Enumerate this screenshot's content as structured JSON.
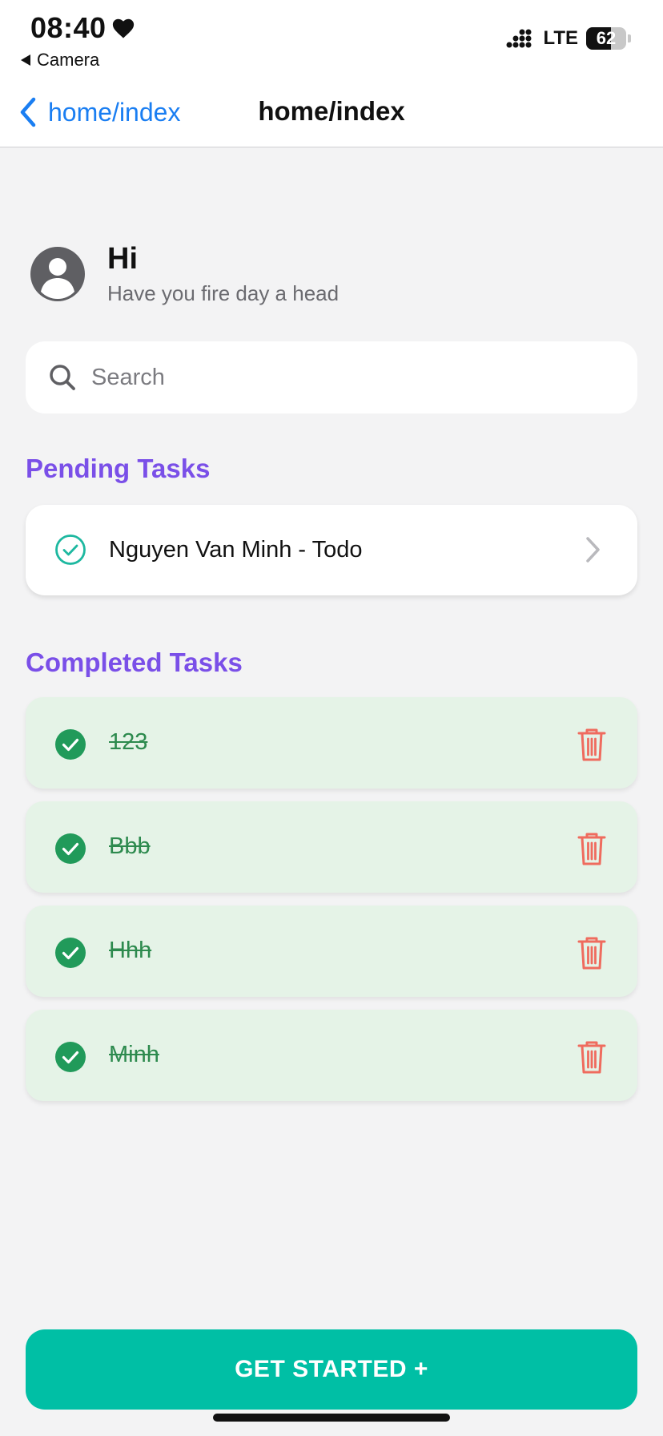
{
  "status_bar": {
    "time": "08:40",
    "back_app": "Camera",
    "network": "LTE",
    "battery": "62",
    "battery_level": 0.62
  },
  "nav": {
    "back_label": "home/index",
    "title": "home/index"
  },
  "greeting": {
    "title": "Hi",
    "subtitle": "Have you fire day a head"
  },
  "search": {
    "placeholder": "Search"
  },
  "pending": {
    "section_title": "Pending Tasks",
    "items": [
      {
        "label": "Nguyen Van Minh - Todo"
      }
    ]
  },
  "completed": {
    "section_title": "Completed Tasks",
    "items": [
      {
        "label": "123"
      },
      {
        "label": "Bbb"
      },
      {
        "label": "Hhh"
      },
      {
        "label": "Minh"
      }
    ]
  },
  "cta": {
    "label": "GET STARTED +"
  },
  "colors": {
    "accent_purple": "#7a4fe8",
    "link_blue": "#1a7ef2",
    "cta_teal": "#00bfa5",
    "done_green": "#219a5a",
    "done_bg": "#e5f3e7",
    "trash_red": "#ef6b5e"
  },
  "icons": {
    "status_heart": "heart-icon",
    "nav_back": "chevron-left-icon",
    "avatar": "user-avatar-icon",
    "search": "search-icon",
    "pending_check": "check-circle-outline-icon",
    "pending_chevron": "chevron-right-icon",
    "done_check": "check-circle-filled-icon",
    "delete": "trash-icon"
  }
}
